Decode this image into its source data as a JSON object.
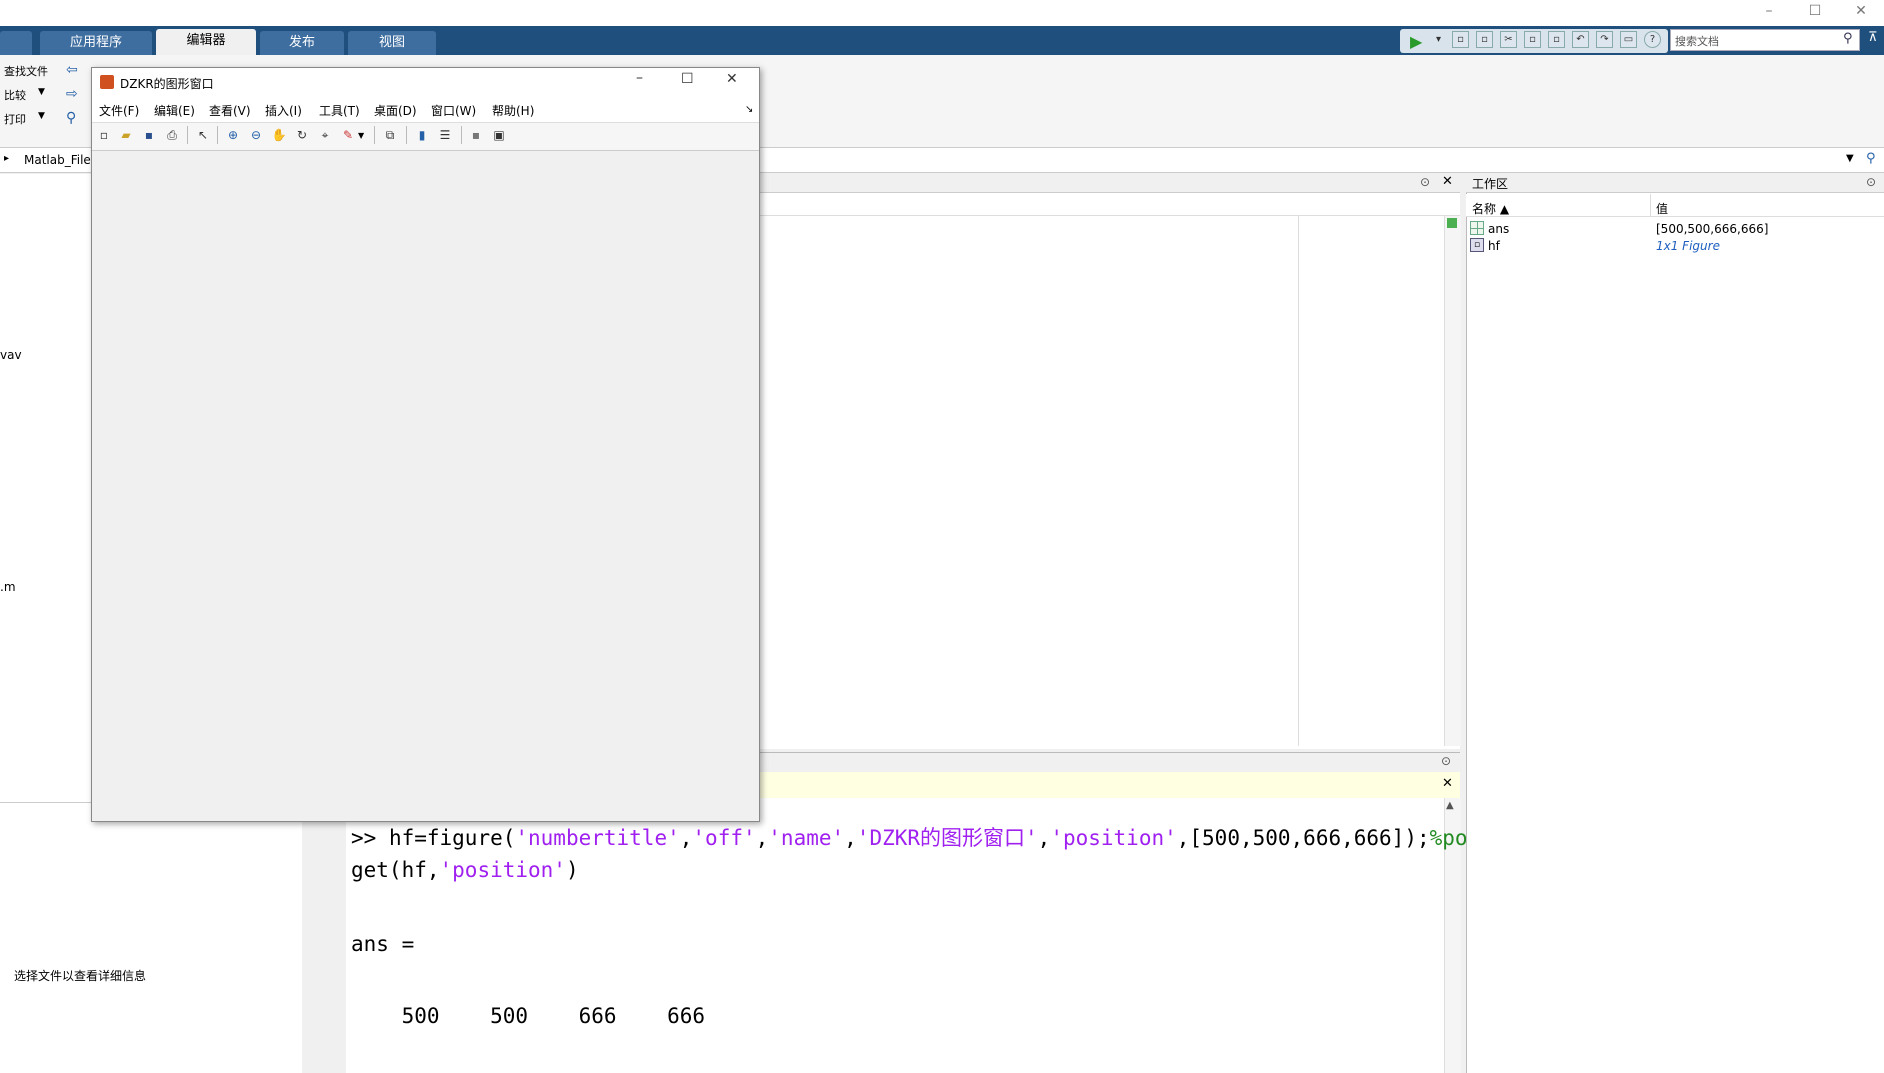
{
  "window": {
    "minimize_icon": "minimize-icon",
    "maximize_icon": "maximize-icon",
    "close_icon": "close-icon"
  },
  "ribbon": {
    "tabs": [
      {
        "label": "应用程序"
      },
      {
        "label": "编辑器"
      },
      {
        "label": "发布"
      },
      {
        "label": "视图"
      }
    ],
    "active_tab": "编辑器",
    "left_group": {
      "find_files": "查找文件",
      "compare": "比较",
      "print": "打印"
    },
    "search_placeholder": "搜索文档"
  },
  "address": {
    "path": "Matlab_File"
  },
  "left_panel": {
    "file_fragment_1": "vav",
    "file_fragment_2": ".m",
    "details_hint": "选择文件以查看详细信息"
  },
  "figure_window": {
    "title": "DZKR的图形窗口",
    "menu": [
      "文件(F)",
      "编辑(E)",
      "查看(V)",
      "插入(I)",
      "工具(T)",
      "桌面(D)",
      "窗口(W)",
      "帮助(H)"
    ]
  },
  "command_window": {
    "prompt": ">> ",
    "line1_prefix": "hf=figure(",
    "line1_args": [
      {
        "text": "'numbertitle'",
        "kind": "str"
      },
      {
        "text": ",",
        "kind": "plain"
      },
      {
        "text": "'off'",
        "kind": "str"
      },
      {
        "text": ",",
        "kind": "plain"
      },
      {
        "text": "'name'",
        "kind": "str"
      },
      {
        "text": ",",
        "kind": "plain"
      },
      {
        "text": "'DZKR的图形窗口'",
        "kind": "str"
      },
      {
        "text": ",",
        "kind": "plain"
      },
      {
        "text": "'position'",
        "kind": "str"
      },
      {
        "text": ",[500,500,666,666]);",
        "kind": "plain"
      },
      {
        "text": "%pos",
        "kind": "cmt"
      }
    ],
    "line2_prefix": "get(hf,",
    "line2_arg": "'position'",
    "line2_suffix": ")",
    "ans_label": "ans =",
    "ans_values": "    500    500    666    666"
  },
  "workspace": {
    "title": "工作区",
    "col_name": "名称 ▲",
    "col_value": "值",
    "vars": [
      {
        "name": "ans",
        "value": "[500,500,666,666]",
        "icon": "matrix-icon"
      },
      {
        "name": "hf",
        "value": "1x1 Figure",
        "icon": "figure-icon"
      }
    ],
    "link_color": "#1f5fbf"
  }
}
